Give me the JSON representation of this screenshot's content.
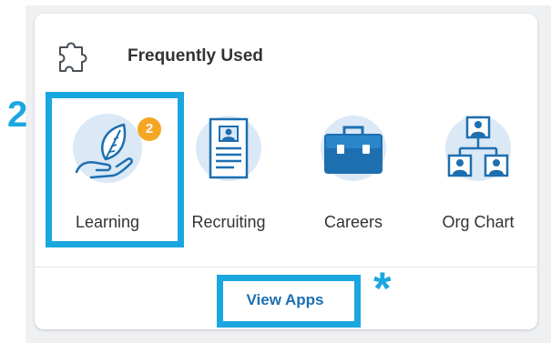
{
  "card": {
    "title": "Frequently Used",
    "icon": "puzzle-icon"
  },
  "apps": [
    {
      "label": "Learning",
      "icon": "learning-hand-leaf-icon",
      "badge": "2"
    },
    {
      "label": "Recruiting",
      "icon": "resume-document-icon"
    },
    {
      "label": "Careers",
      "icon": "briefcase-icon"
    },
    {
      "label": "Org Chart",
      "icon": "org-chart-icon"
    }
  ],
  "footer": {
    "view_apps_label": "View Apps"
  },
  "annotations": {
    "step_number": "2",
    "asterisk": "*",
    "highlight_color": "#1aa7e0"
  },
  "colors": {
    "badge": "#f5a623",
    "link": "#1d6fb0",
    "icon_blue": "#1d6fb0",
    "icon_circle": "#dbe8f6"
  }
}
